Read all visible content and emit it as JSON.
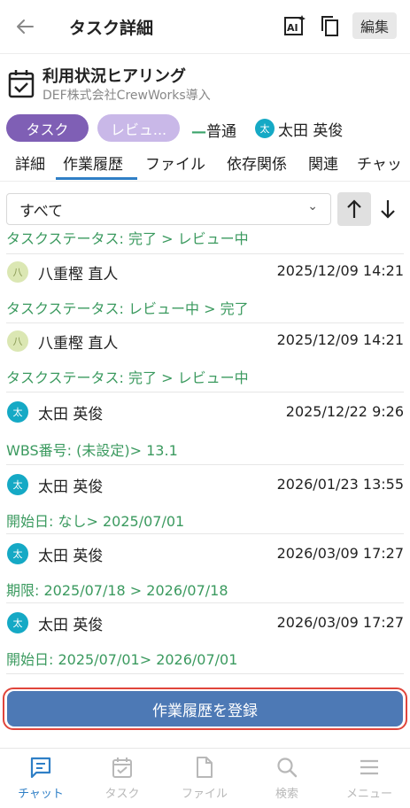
{
  "header": {
    "title": "タスク詳細",
    "edit_label": "編集"
  },
  "task": {
    "name": "利用状況ヒアリング",
    "project": "DEF株式会社CrewWorks導入",
    "type_chip": "タスク",
    "status_chip": "レビュ...",
    "priority_mark": "—",
    "priority": "普通",
    "assignee_initial": "太",
    "assignee": "太田 英俊"
  },
  "tabs": [
    {
      "label": "詳細"
    },
    {
      "label": "作業履歴",
      "active": true
    },
    {
      "label": "ファイル"
    },
    {
      "label": "依存関係"
    },
    {
      "label": "関連"
    },
    {
      "label": "チャッ"
    }
  ],
  "filter": {
    "selected": "すべて",
    "chevron": "⌄"
  },
  "history": {
    "top_change": "タスクステータス: 完了 > レビュー中",
    "entries": [
      {
        "initial": "八",
        "user": "八重樫 直人",
        "timestamp": "2025/12/09 14:21",
        "change": "タスクステータス: レビュー中 > 完了",
        "avatar": "green"
      },
      {
        "initial": "八",
        "user": "八重樫 直人",
        "timestamp": "2025/12/09 14:21",
        "change": "タスクステータス: 完了 > レビュー中",
        "avatar": "green"
      },
      {
        "initial": "太",
        "user": "太田 英俊",
        "timestamp": "2025/12/22 9:26",
        "change": "WBS番号: (未設定)> 13.1",
        "avatar": "blue"
      },
      {
        "initial": "太",
        "user": "太田 英俊",
        "timestamp": "2026/01/23 13:55",
        "change": "開始日: なし> 2025/07/01",
        "avatar": "blue"
      },
      {
        "initial": "太",
        "user": "太田 英俊",
        "timestamp": "2026/03/09 17:27",
        "change": "期限: 2025/07/18 > 2026/07/18",
        "avatar": "blue"
      },
      {
        "initial": "太",
        "user": "太田 英俊",
        "timestamp": "2026/03/09 17:27",
        "change": "開始日: 2025/07/01> 2026/07/01",
        "avatar": "blue"
      }
    ]
  },
  "register_button": "作業履歴を登録",
  "bottom_nav": [
    {
      "label": "チャット",
      "icon": "chat-icon",
      "active": true
    },
    {
      "label": "タスク",
      "icon": "task-icon"
    },
    {
      "label": "ファイル",
      "icon": "file-icon"
    },
    {
      "label": "検索",
      "icon": "search-icon"
    },
    {
      "label": "メニュー",
      "icon": "menu-icon"
    }
  ],
  "colors": {
    "accent": "#2f7fc6",
    "chip_task": "#7f5fb5",
    "chip_review": "#c9b8e8",
    "change_text": "#3b9a5f",
    "register_button": "#4d79b5",
    "highlight": "#e0453b"
  }
}
